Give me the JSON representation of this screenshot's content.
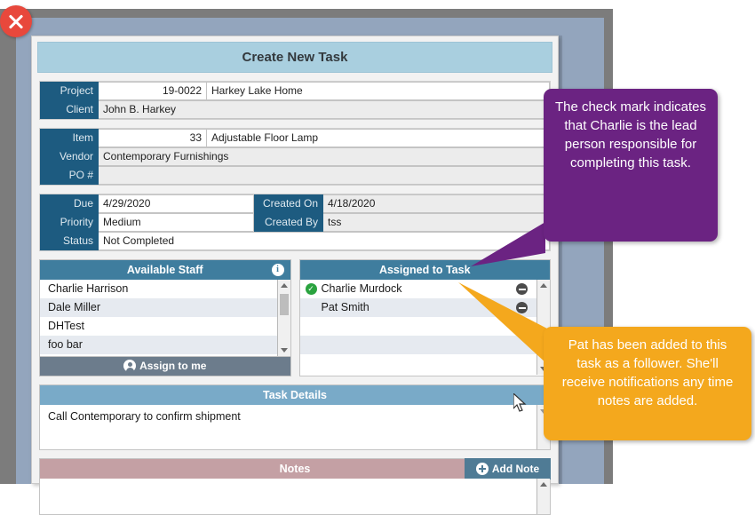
{
  "window": {
    "close_icon": "close-icon"
  },
  "dialog": {
    "title": "Create New Task"
  },
  "project_block": {
    "rows": [
      {
        "label": "Project",
        "value_num": "19-0022",
        "value_text": "Harkey Lake Home"
      },
      {
        "label": "Client",
        "value_text": "John B. Harkey"
      }
    ]
  },
  "item_block": {
    "rows": [
      {
        "label": "Item",
        "value_num": "33",
        "value_text": "Adjustable Floor Lamp"
      },
      {
        "label": "Vendor",
        "value_text": "Contemporary Furnishings"
      },
      {
        "label": "PO #",
        "value_text": ""
      }
    ]
  },
  "dates_block": {
    "rows": [
      {
        "label": "Due",
        "value": "4/29/2020",
        "label2": "Created On",
        "value2": "4/18/2020"
      },
      {
        "label": "Priority",
        "value": "Medium",
        "label2": "Created By",
        "value2": "tss"
      },
      {
        "label": "Status",
        "value": "Not Completed"
      }
    ]
  },
  "available_staff": {
    "header": "Available Staff",
    "info_icon": "info-icon",
    "info_glyph": "i",
    "items": [
      {
        "name": "Charlie Harrison"
      },
      {
        "name": "Dale Miller"
      },
      {
        "name": "DHTest"
      },
      {
        "name": "foo bar"
      }
    ],
    "assign_button": "Assign to me",
    "assign_icon": "person-icon"
  },
  "assigned_to_task": {
    "header": "Assigned to Task",
    "items": [
      {
        "name": "Charlie Murdock",
        "lead": true,
        "check_glyph": "✓",
        "remove_icon": "remove-circle-icon"
      },
      {
        "name": "Pat Smith",
        "lead": false,
        "remove_icon": "remove-circle-icon"
      }
    ]
  },
  "task_details": {
    "header": "Task Details",
    "text": "Call Contemporary to confirm shipment"
  },
  "notes": {
    "header": "Notes",
    "add_label": "Add Note",
    "add_icon": "plus-circle-icon",
    "text": ""
  },
  "callouts": {
    "purple": "The check mark indicates that Charlie is the lead person responsible for completing this task.",
    "orange": "Pat has been added to this task as a follower. She'll receive notifications any time notes are added."
  },
  "colors": {
    "accent_dark": "#1d5b80",
    "panel_header": "#3f7d9e",
    "title_bar": "#a9cfdf",
    "section_blue": "#79aac8",
    "section_rose": "#c4a0a4",
    "callout_purple": "#6b2382",
    "callout_orange": "#f4a81d",
    "close_red": "#e8483c",
    "lead_green": "#2aa33f"
  }
}
